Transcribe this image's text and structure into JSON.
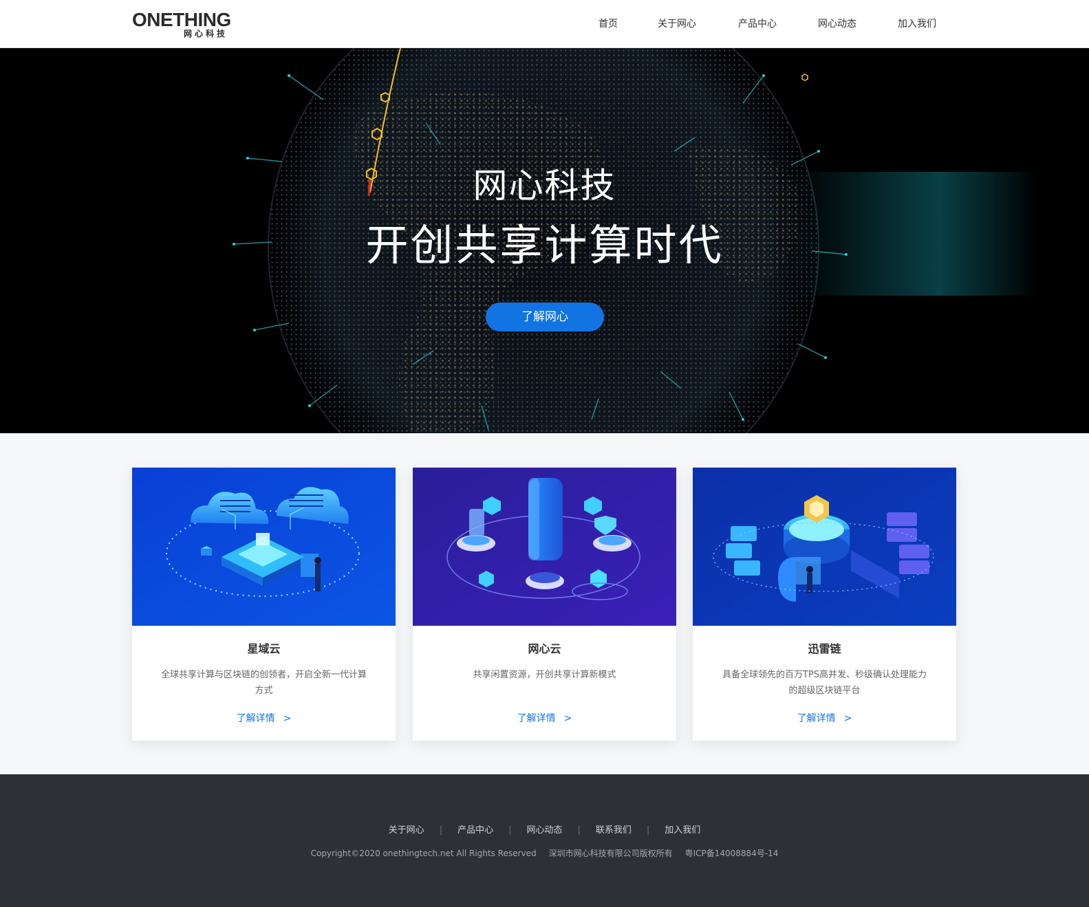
{
  "header": {
    "logo": {
      "word": "ONETHING",
      "sub": "网心科技"
    },
    "nav": [
      "首页",
      "关于网心",
      "产品中心",
      "网心动态",
      "加入我们"
    ]
  },
  "hero": {
    "title": "网心科技",
    "subtitle": "开创共享计算时代",
    "button": "了解网心"
  },
  "products": [
    {
      "title": "星域云",
      "desc": "全球共享计算与区块链的创领者，开启全新一代计算方式",
      "link": "了解详情",
      "arrow": ">"
    },
    {
      "title": "网心云",
      "desc": "共享闲置资源，开创共享计算新模式",
      "link": "了解详情",
      "arrow": ">"
    },
    {
      "title": "迅雷链",
      "desc": "具备全球领先的百万TPS高并发、秒级确认处理能力的超级区块链平台",
      "link": "了解详情",
      "arrow": ">"
    }
  ],
  "footer": {
    "links": [
      "关于网心",
      "产品中心",
      "网心动态",
      "联系我们",
      "加入我们"
    ],
    "separator": "|",
    "copyright": "Copyright©2020 onethingtech.net All Rights Reserved",
    "company": "深圳市网心科技有限公司版权所有",
    "icp": "粤ICP备14008884号-14"
  },
  "colors": {
    "accent": "#1273e3",
    "footer_bg": "#2e3038",
    "hero_bg": "#000000",
    "page_bg": "#f5f6f8"
  }
}
